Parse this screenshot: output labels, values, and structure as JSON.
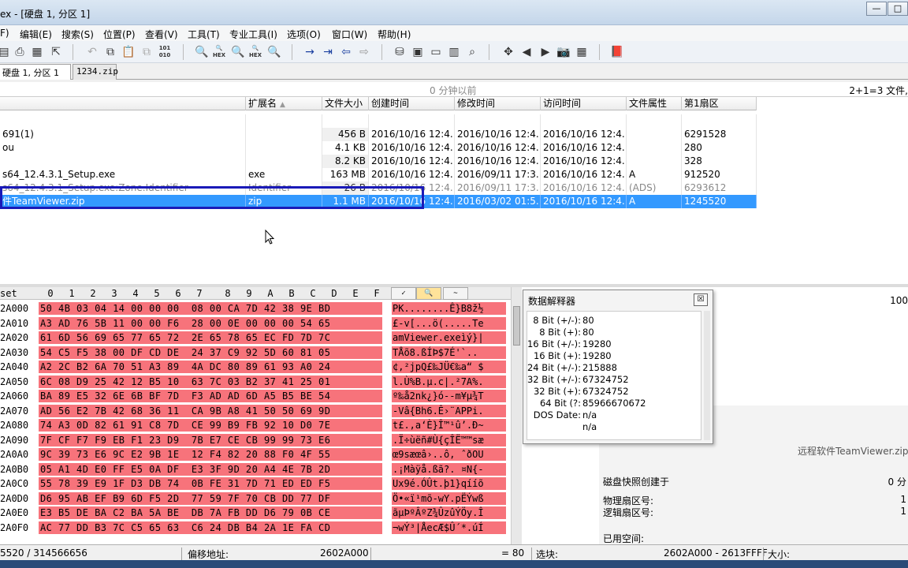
{
  "window": {
    "title": "ex - [硬盘 1, 分区 1]",
    "controls": [
      "—",
      "□"
    ]
  },
  "menu": [
    "F)",
    "编辑(E)",
    "搜索(S)",
    "位置(P)",
    "查看(V)",
    "工具(T)",
    "专业工具(I)",
    "选项(O)",
    "窗口(W)",
    "帮助(H)"
  ],
  "tabs": [
    {
      "label": "硬盘 1, 分区 1",
      "active": true
    },
    {
      "label": "1234.zip",
      "active": false
    }
  ],
  "infobar": {
    "snapshot_time": "0 分钟以前",
    "file_count": "2+1=3 文件,"
  },
  "filelist": {
    "columns": [
      "",
      "扩展名",
      "文件大小",
      "创建时间",
      "修改时间",
      "访问时间",
      "文件属性",
      "第1扇区"
    ],
    "rows": [
      {
        "name": "",
        "ext": "",
        "size": "",
        "created": "",
        "modified": "",
        "accessed": "",
        "attr": "",
        "sector": ""
      },
      {
        "name": "691(1)",
        "ext": "",
        "size": "456 B",
        "created": "2016/10/16  12:4...",
        "modified": "2016/10/16  12:4...",
        "accessed": "2016/10/16  12:4...",
        "attr": "",
        "sector": "6291528"
      },
      {
        "name": "ou",
        "ext": "",
        "size": "4.1 KB",
        "created": "2016/10/16  12:4...",
        "modified": "2016/10/16  12:4...",
        "accessed": "2016/10/16  12:4...",
        "attr": "",
        "sector": "280"
      },
      {
        "name": "",
        "ext": "",
        "size": "8.2 KB",
        "created": "2016/10/16  12:4...",
        "modified": "2016/10/16  12:4...",
        "accessed": "2016/10/16  12:4...",
        "attr": "",
        "sector": "328"
      },
      {
        "name": "s64_12.4.3.1_Setup.exe",
        "ext": "exe",
        "size": "163 MB",
        "created": "2016/10/16  12:4...",
        "modified": "2016/09/11  17:3...",
        "accessed": "2016/10/16  12:4...",
        "attr": "A",
        "sector": "912520"
      },
      {
        "name": "s64_12.4.3.1_Setup.exe:Zone.Identifier",
        "ext": "Identifier",
        "size": "26 B",
        "created": "2016/10/16  12:4...",
        "modified": "2016/09/11  17:3...",
        "accessed": "2016/10/16  12:4...",
        "attr": "(ADS)",
        "sector": "6293612"
      },
      {
        "name": "件TeamViewer.zip",
        "ext": "zip",
        "size": "1.1 MB",
        "created": "2016/10/16  12:4...",
        "modified": "2016/03/02  01:5...",
        "accessed": "2016/10/16  12:4...",
        "attr": "A",
        "sector": "1245520"
      }
    ]
  },
  "hex": {
    "offset_label": "set",
    "columns": [
      "0",
      "1",
      "2",
      "3",
      "4",
      "5",
      "6",
      "7",
      "8",
      "9",
      "A",
      "B",
      "C",
      "D",
      "E",
      "F"
    ],
    "rows": [
      {
        "offset": "2A000",
        "bytes": "50 4B 03 04 14 00 00 00  08 00 CA 7D 42 38 9E BD",
        "text": "PK........Ê}B8ž½"
      },
      {
        "offset": "2A010",
        "bytes": "A3 AD 76 5B 11 00 00 F6  28 00 0E 00 00 00 54 65",
        "text": "£-v[...ö(.....Te"
      },
      {
        "offset": "2A020",
        "bytes": "61 6D 56 69 65 77 65 72  2E 65 78 65 EC FD 7D 7C",
        "text": "amViewer.exeìý}|"
      },
      {
        "offset": "2A030",
        "bytes": "54 C5 F5 38 00 DF CD DE  24 37 C9 92 5D 60 81 05",
        "text": "TÅõ8.ßÍÞ$7É'`.."
      },
      {
        "offset": "2A040",
        "bytes": "A2 2C B2 6A 70 51 A3 89  4A DC 80 89 61 93 A0 24",
        "text": "¢,²jpQ£‰JÜ€‰a“ $"
      },
      {
        "offset": "2A050",
        "bytes": "6C 08 D9 25 42 12 B5 10  63 7C 03 B2 37 41 25 01",
        "text": "l.Ù%B.µ.c|.²7A%."
      },
      {
        "offset": "2A060",
        "bytes": "BA 89 E5 32 6E 6B BF 7D  F3 AD AD 6D A5 B5 BE 54",
        "text": "º‰å2nk¿}ó--m¥µ¾T"
      },
      {
        "offset": "2A070",
        "bytes": "AD 56 E2 7B 42 68 36 11  CA 9B A8 41 50 50 69 9D",
        "text": "-Vâ{Bh6.Ê›¨APPi."
      },
      {
        "offset": "2A080",
        "bytes": "74 A3 0D 82 61 91 C8 7D  CE 99 B9 FB 92 10 D0 7E",
        "text": "t£.‚a‘È}Î™¹û’.Ð~"
      },
      {
        "offset": "2A090",
        "bytes": "7F CF F7 F9 EB F1 23 D9  7B E7 CE CB 99 99 73 E6",
        "text": ".Ï÷ùëñ#Ù{çÎË™™sæ"
      },
      {
        "offset": "2A0A0",
        "bytes": "9C 39 73 E6 9C E2 9B 1E  12 F4 82 20 88 F0 4F 55",
        "text": "œ9sæœâ›..ô‚ ˆðOU"
      },
      {
        "offset": "2A0B0",
        "bytes": "05 A1 4D E0 FF E5 0A DF  E3 3F 9D 20 A4 4E 7B 2D",
        "text": ".¡Màÿå.ßã?. ¤N{-"
      },
      {
        "offset": "2A0C0",
        "bytes": "55 78 39 E9 1F D3 DB 74  0B FE 31 7D 71 ED ED F5",
        "text": "Ux9é.ÓÛt.þ1}qííõ"
      },
      {
        "offset": "2A0D0",
        "bytes": "D6 95 AB EF B9 6D F5 2D  77 59 7F 70 CB DD 77 DF",
        "text": "Ö•«ï¹mõ-wY.pËÝwß"
      },
      {
        "offset": "2A0E0",
        "bytes": "E3 B5 DE BA C2 BA 5A BE  DB 7A FB DD D6 79 0B CE",
        "text": "ãµÞºÂºZ¾ÛzûÝÖy.Î"
      },
      {
        "offset": "2A0F0",
        "bytes": "AC 77 DD B3 7C C5 65 63  C6 24 DB B4 2A 1E FA CD",
        "text": "¬wÝ³|ÅecÆ$Û´*.úÍ"
      }
    ]
  },
  "interpreter": {
    "title": "数据解释器",
    "rows": [
      {
        "label": "8 Bit (+/-):",
        "value": "80"
      },
      {
        "label": "8 Bit (+):",
        "value": "80"
      },
      {
        "label": "16 Bit (+/-):",
        "value": "19280"
      },
      {
        "label": "16 Bit (+):",
        "value": "19280"
      },
      {
        "label": "24 Bit (+/-):",
        "value": "215888"
      },
      {
        "label": "32 Bit (+/-):",
        "value": "67324752"
      },
      {
        "label": "32 Bit (+):",
        "value": "67324752"
      },
      {
        "label": "64 Bit (?:",
        "value": "85966670672"
      },
      {
        "label": "DOS Date:",
        "value": "n/a"
      },
      {
        "label": "",
        "value": "n/a"
      }
    ]
  },
  "rightpane": {
    "top_right_value": "100",
    "filename": "远程软件TeamViewer.zip (",
    "snapshot_label": "磁盘快照创建于",
    "snapshot_value": "0 分",
    "phys_sector_label": "物理扇区号:",
    "phys_sector_value": "1",
    "logical_sector_label": "逻辑扇区号:",
    "logical_sector_value": "1",
    "used_space_label": "已用空间:"
  },
  "statusbar": {
    "sector": "5520 / 314566656",
    "offset_label": "偏移地址:",
    "offset_value": "2602A000",
    "value": "= 80",
    "block_label": "选块:",
    "block_value": "2602A000 - 2613FFFF",
    "size_label": "大小:"
  }
}
